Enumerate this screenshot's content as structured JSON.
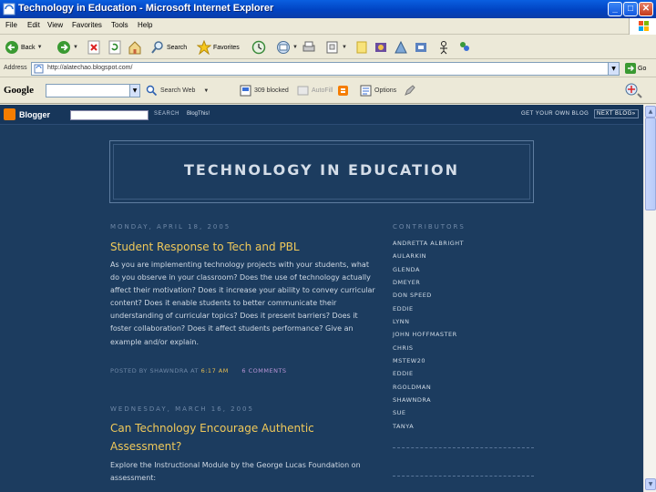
{
  "window": {
    "title": "Technology in Education - Microsoft Internet Explorer",
    "minimize": "_",
    "maximize": "□",
    "close": "✕"
  },
  "menu": [
    "File",
    "Edit",
    "View",
    "Favorites",
    "Tools",
    "Help"
  ],
  "toolbar": {
    "back": "Back",
    "search": "Search",
    "favorites": "Favorites"
  },
  "address": {
    "label": "Address",
    "url": "http://alatechao.blogspot.com/",
    "go": "Go"
  },
  "google_toolbar": {
    "logo": "Google",
    "search_web": "Search Web",
    "blocked": "309 blocked",
    "autofill": "AutoFill",
    "options": "Options"
  },
  "navbar": {
    "logo": "Blogger",
    "search_button": "SEARCH",
    "blog_this": "BlogThis!",
    "get_blog": "GET YOUR OWN BLOG",
    "next_blog": "NEXT BLOG»"
  },
  "blog": {
    "title": "TECHNOLOGY IN EDUCATION"
  },
  "posts": [
    {
      "date": "MONDAY, APRIL 18, 2005",
      "title": "Student Response to Tech and PBL",
      "body": "As you are implementing technology projects with your students, what do you observe in your classroom? Does the use of technology actually affect their motivation? Does it increase your ability to convey curricular content? Does it enable students to better communicate their understanding of curricular topics? Does it present barriers? Does it foster collaboration? Does it affect students performance? Give an example and/or explain.",
      "posted_by": "POSTED BY SHAWNDRA AT",
      "time": "6:17 AM",
      "comments": "6 COMMENTS"
    },
    {
      "date": "WEDNESDAY, MARCH 16, 2005",
      "title": "Can Technology Encourage Authentic Assessment?",
      "body": "Explore the Instructional Module by the George Lucas Foundation on assessment:"
    }
  ],
  "sidebar": {
    "heading": "CONTRIBUTORS",
    "contributors": [
      "ANDRETTA ALBRIGHT",
      "AULARKIN",
      "GLENDA",
      "DMEYER",
      "DON SPEED",
      "EDDIE",
      "LYNN",
      "JOHN HOFFMASTER",
      "CHRIS",
      "MSTEW20",
      "EDDIE",
      "RGOLDMAN",
      "SHAWNDRA",
      "SUE",
      "TANYA"
    ]
  }
}
